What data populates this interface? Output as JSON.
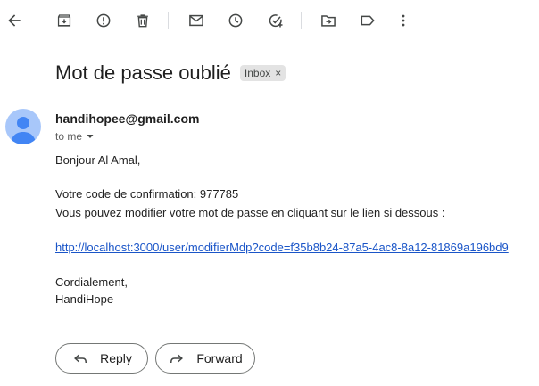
{
  "toolbar": {
    "icons": [
      "back-arrow-icon",
      "archive-icon",
      "report-spam-icon",
      "delete-icon",
      "mark-unread-icon",
      "snooze-icon",
      "add-to-tasks-icon",
      "move-to-icon",
      "label-icon",
      "more-options-icon"
    ]
  },
  "email": {
    "subject": "Mot de passe oublié",
    "label_chip": "Inbox",
    "sender": "handihopee@gmail.com",
    "recipient_label": "to me",
    "greeting": "Bonjour Al Amal,",
    "code_line": "Votre code de confirmation: 977785",
    "instruction_line": "Vous pouvez modifier votre mot de passe en cliquant sur le lien si dessous  :",
    "link": "http://localhost:3000/user/modifierMdp?code=f35b8b24-87a5-4ac8-8a12-81869a196bd9",
    "closing": "Cordialement,",
    "signature": "HandiHope"
  },
  "actions": {
    "reply_label": "Reply",
    "forward_label": "Forward"
  },
  "colors": {
    "link": "#1a55c8",
    "avatar_bg": "#a8c7fa",
    "avatar_fg": "#4285f4",
    "chip_bg": "#e3e3e3"
  }
}
